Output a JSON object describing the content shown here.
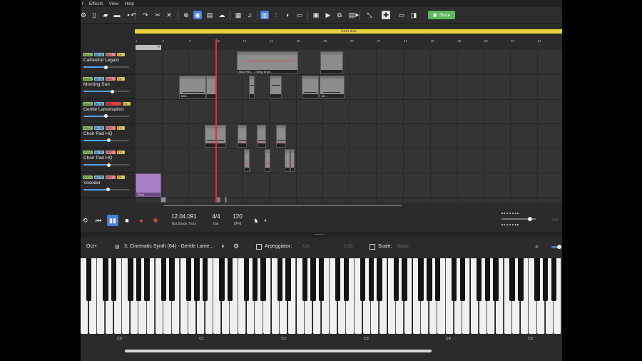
{
  "menu": [
    "t",
    "Effects",
    "View",
    "Help"
  ],
  "toolbar": {
    "store_label": "Store"
  },
  "timeline": {
    "loop_label": "*1013 Bars",
    "ruler": [
      "1",
      "5",
      "9",
      "13",
      "17",
      "21",
      "25",
      "29",
      "33",
      "37",
      "41",
      "45",
      "49",
      "53",
      "57",
      "61"
    ]
  },
  "tracks": [
    {
      "name": "Cathedral Legato",
      "rec_on": false,
      "volume": 0.48
    },
    {
      "name": "Morning Sun",
      "rec_on": false,
      "volume": 0.62
    },
    {
      "name": "Gentle Lamentation",
      "rec_on": true,
      "volume": 0.48
    },
    {
      "name": "Choir Pad HQ",
      "rec_on": false,
      "volume": 0.55
    },
    {
      "name": "Choir Pad HQ",
      "rec_on": false,
      "volume": 0.55
    },
    {
      "name": "Vocoder",
      "rec_on": false,
      "volume": 0.53
    }
  ],
  "track_buttons": {
    "solo": "SOLO",
    "mute": "MUTE",
    "rec": "REC",
    "fx": "FX"
  },
  "clips": {
    "midi_rec_label": "MIDI REC →String Ense...",
    "mi_label": "MID...",
    "mi2_label": "MI...",
    "vocoder_label": "Voca..."
  },
  "transport": {
    "position": "12.04.091",
    "position_label": "Bar.Beats.Ticks",
    "signature": "4/4",
    "signature_label": "Bar",
    "tempo": "120",
    "tempo_label": "BPM",
    "meter_label": "003",
    "meter_level": 0.83
  },
  "keyboard_bar": {
    "octave_label": "Oct+",
    "instrument": "3: Cinematic Synth (64) - Gentle Lame...",
    "arpeggiator_label": "Arpeggiator:",
    "arp_mode": "Up",
    "arp_rate": "1/16",
    "scale_label": "Scale:",
    "scale_value": "Major"
  },
  "octave_labels": [
    "C0",
    "C1",
    "C2",
    "C3",
    "C4",
    "C5"
  ],
  "colors": {
    "accent": "#4a7fd4",
    "loop": "#e9d23a",
    "playhead": "#e03030",
    "store": "#5cb85c"
  }
}
